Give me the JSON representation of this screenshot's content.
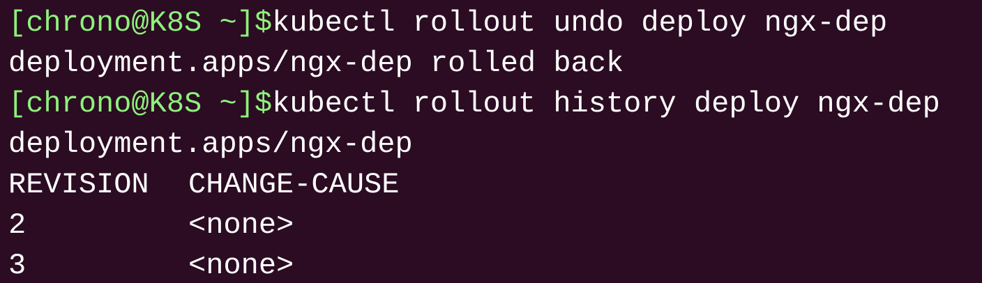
{
  "terminal": {
    "prompt": "[chrono@K8S ~]$",
    "colors": {
      "background": "#2b0c22",
      "prompt": "#8ef17c",
      "text": "#ffffff"
    },
    "commands": [
      "kubectl rollout undo deploy ngx-dep",
      "kubectl rollout history deploy ngx-dep"
    ],
    "outputs": {
      "undo_result": "deployment.apps/ngx-dep rolled back",
      "history_header": "deployment.apps/ngx-dep"
    },
    "history_table": {
      "columns": [
        "REVISION",
        "CHANGE-CAUSE"
      ],
      "rows": [
        [
          "2",
          "<none>"
        ],
        [
          "3",
          "<none>"
        ]
      ]
    }
  }
}
